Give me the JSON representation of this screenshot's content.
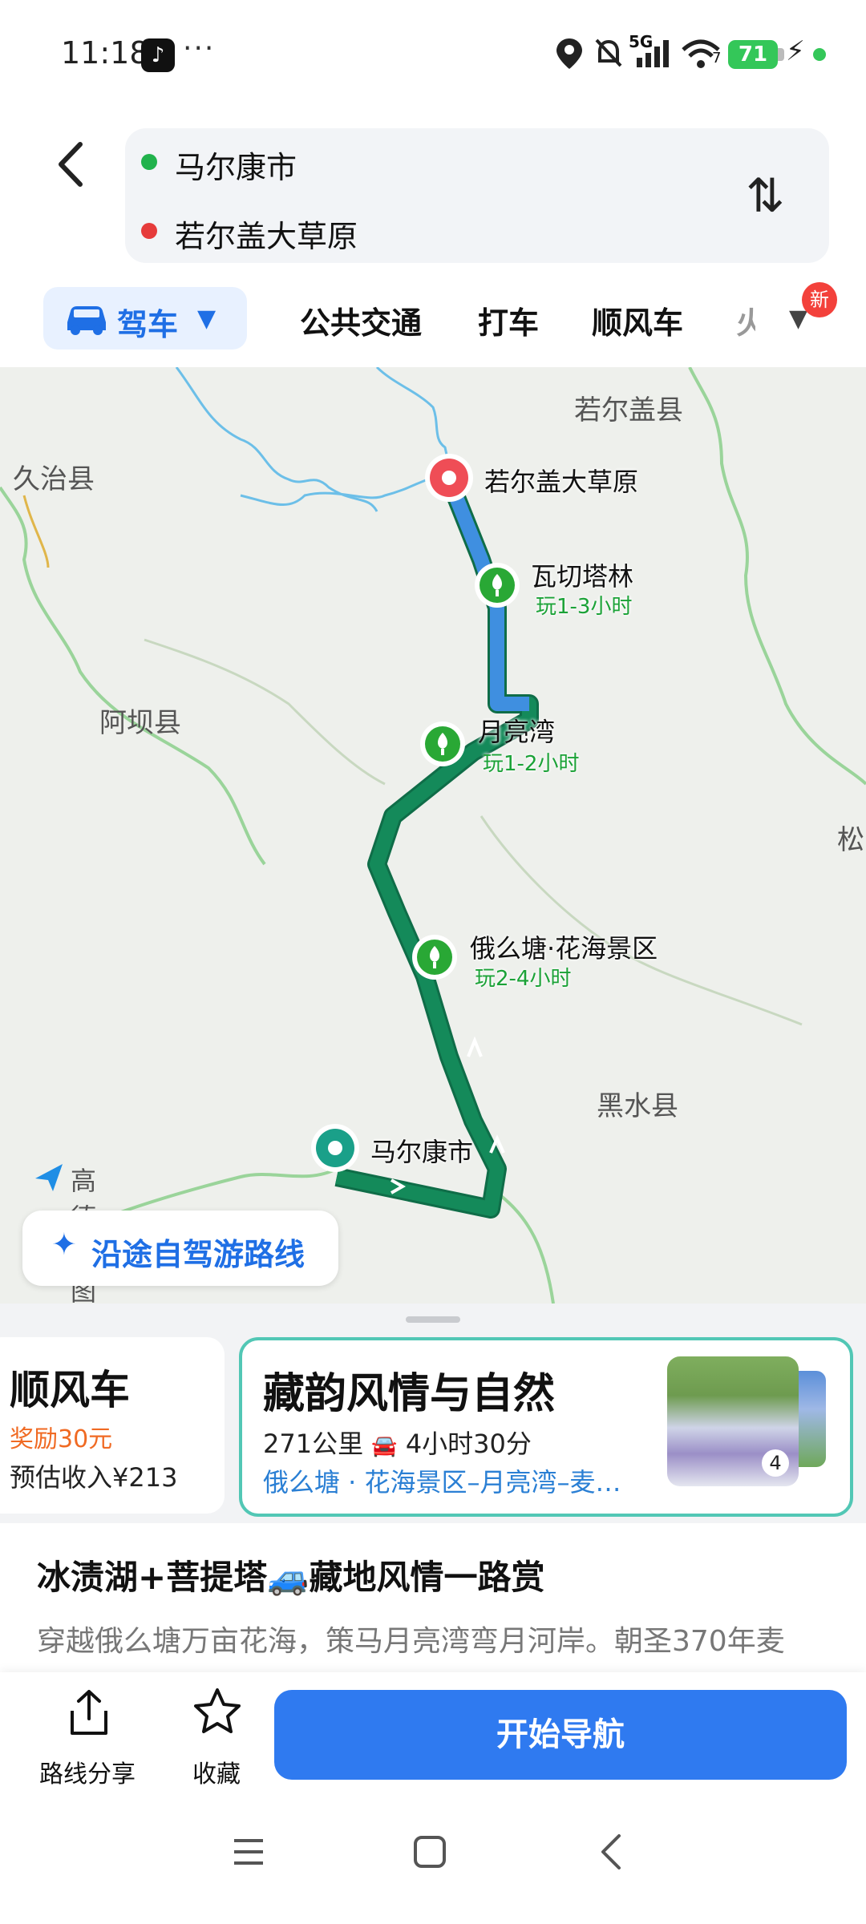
{
  "status_bar": {
    "time": "11:18",
    "network": "5G",
    "wifi_badge": "7",
    "battery": "71",
    "dots": "···"
  },
  "route": {
    "origin": "马尔康市",
    "destination": "若尔盖大草原",
    "origin_color": "#21b24c",
    "destination_color": "#e63b3b"
  },
  "modes": {
    "active": "驾车",
    "tabs": [
      "公共交通",
      "打车",
      "顺风车",
      "火"
    ],
    "badge": "新"
  },
  "map": {
    "region_labels": [
      "若尔盖县",
      "久治县",
      "阿坝县",
      "松",
      "黑水县"
    ],
    "pois": [
      {
        "name": "若尔盖大草原",
        "time": ""
      },
      {
        "name": "瓦切塔林",
        "time": "玩1-3小时"
      },
      {
        "name": "月亮湾",
        "time": "玩1-2小时"
      },
      {
        "name": "俄么塘·花海景区",
        "time": "玩2-4小时"
      },
      {
        "name": "马尔康市",
        "time": ""
      }
    ],
    "logo_text": "高德地图",
    "self_drive_button": "沿途自驾游路线",
    "route_color": "#148a5a"
  },
  "cards": {
    "ride": {
      "title": "顺风车",
      "reward": "奖励30元",
      "income": "预估收入¥213"
    },
    "route": {
      "title": "藏韵风情与自然",
      "distance": "271公里",
      "duration": "4小时30分",
      "stops": "俄么塘 · 花海景区–月亮湾–麦…",
      "photo_count": "4"
    }
  },
  "description": {
    "title": "冰渍湖+菩提塔🚙藏地风情一路赏",
    "text": "穿越俄么塘万亩花海，策马月亮湾弯月河岸。朝圣370年麦"
  },
  "actions": {
    "share": "路线分享",
    "favorite": "收藏",
    "navigate": "开始导航"
  }
}
